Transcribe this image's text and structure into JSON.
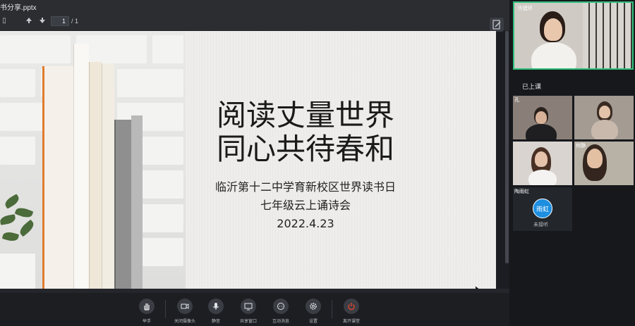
{
  "viewer": {
    "file_name": "书分享.pptx",
    "current_page": "1",
    "total_pages": "/ 1"
  },
  "slide": {
    "title_line1": "阅读丈量世界",
    "title_line2": "同心共待春和",
    "subtitle_line1": "临沂第十二中学育新校区世界读书日",
    "subtitle_line2": "七年级云上诵诗会",
    "date": "2022.4.23"
  },
  "controls": [
    {
      "label": "举手",
      "icon": "raise-hand-icon"
    },
    {
      "label": "关闭摄像头",
      "icon": "camera-icon"
    },
    {
      "label": "静音",
      "icon": "microphone-icon"
    },
    {
      "label": "共享窗口",
      "icon": "share-screen-icon"
    },
    {
      "label": "互动消息",
      "icon": "chat-icon"
    },
    {
      "label": "设置",
      "icon": "gear-icon"
    },
    {
      "label": "离开课堂",
      "icon": "power-icon"
    }
  ],
  "participants": {
    "presenter_name": "许建环",
    "section_label": "已上课",
    "tiles": [
      {
        "name": "孔"
      },
      {
        "name": ""
      },
      {
        "name": ""
      },
      {
        "name": "何静"
      }
    ],
    "no_video": {
      "name": "陶雨虹",
      "avatar_text": "雨虹",
      "status": "未接听"
    }
  },
  "colors": {
    "active_speaker_border": "#2fbf7a",
    "avatar": "#1e8fe0",
    "leave_button": "#e0452f"
  }
}
